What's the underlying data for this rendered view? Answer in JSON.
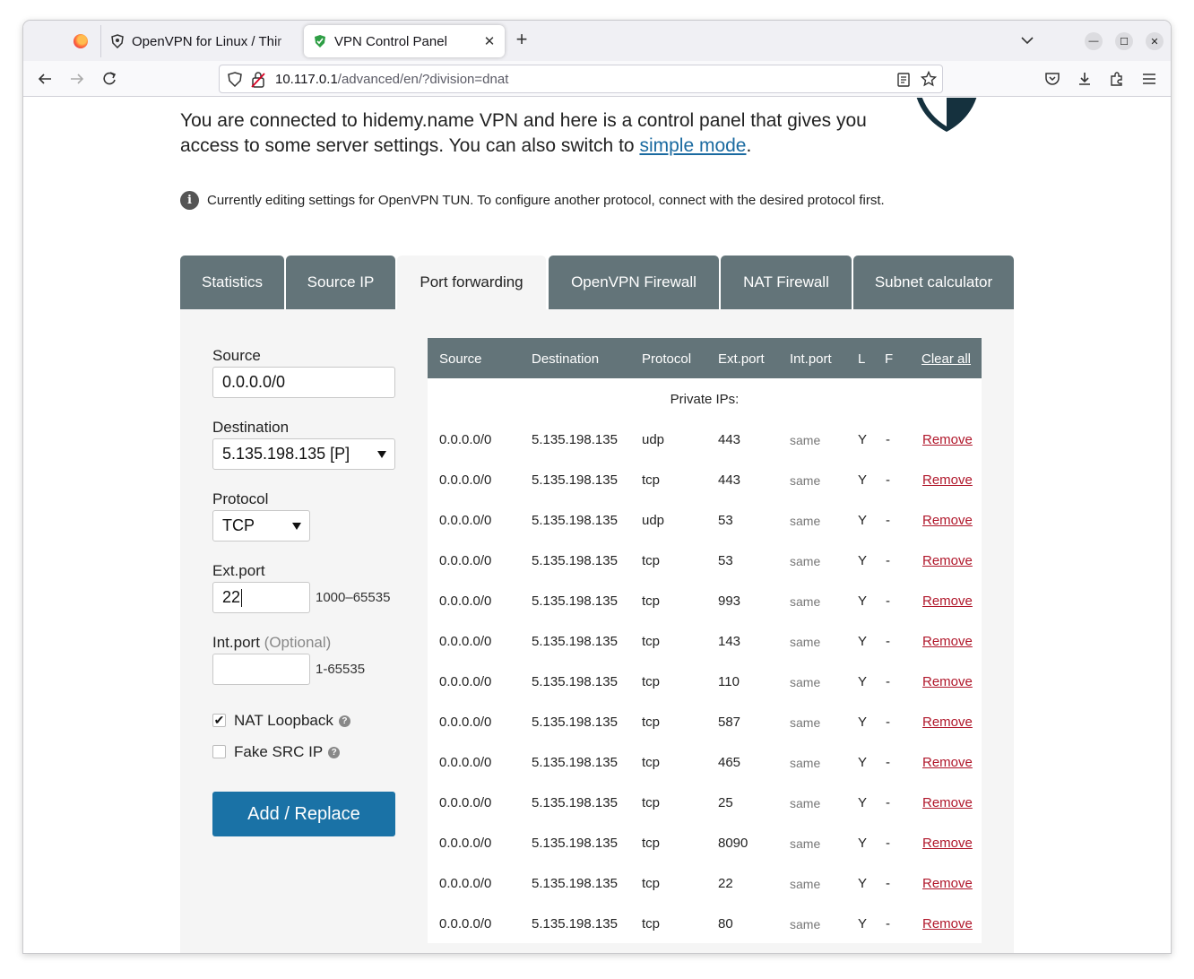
{
  "browser": {
    "tabs": [
      {
        "title": "OpenVPN for Linux / Thir",
        "active": false
      },
      {
        "title": "VPN Control Panel",
        "active": true
      }
    ],
    "url_host": "10.117.0.1",
    "url_path": "/advanced/en/?division=dnat"
  },
  "intro": {
    "text": "You are connected to hidemy.name VPN and here is a control panel that gives you access to some server settings. You can also switch to",
    "link": "simple mode",
    "end": "."
  },
  "info": "Currently editing settings for OpenVPN TUN. To configure another protocol, connect with the desired protocol first.",
  "page_tabs": [
    "Statistics",
    "Source IP",
    "Port forwarding",
    "OpenVPN Firewall",
    "NAT Firewall",
    "Subnet calculator"
  ],
  "form": {
    "source_label": "Source",
    "source_value": "0.0.0.0/0",
    "destination_label": "Destination",
    "destination_value": "5.135.198.135 [P]",
    "protocol_label": "Protocol",
    "protocol_value": "TCP",
    "ext_port_label": "Ext.port",
    "ext_port_value": "22",
    "ext_port_range": "1000–65535",
    "int_port_label": "Int.port",
    "int_port_optional": "(Optional)",
    "int_port_value": "",
    "int_port_range": "1-65535",
    "nat_loopback_label": "NAT Loopback",
    "nat_loopback_checked": true,
    "fake_src_label": "Fake SRC IP",
    "fake_src_checked": false,
    "submit_label": "Add / Replace"
  },
  "table": {
    "headers": [
      "Source",
      "Destination",
      "Protocol",
      "Ext.port",
      "Int.port",
      "L",
      "F"
    ],
    "clear_all": "Clear all",
    "private_ips_label": "Private IPs:",
    "remove_label": "Remove",
    "rows": [
      {
        "source": "0.0.0.0/0",
        "destination": "5.135.198.135",
        "protocol": "udp",
        "ext": "443",
        "int": "same",
        "l": "Y",
        "f": "-"
      },
      {
        "source": "0.0.0.0/0",
        "destination": "5.135.198.135",
        "protocol": "tcp",
        "ext": "443",
        "int": "same",
        "l": "Y",
        "f": "-"
      },
      {
        "source": "0.0.0.0/0",
        "destination": "5.135.198.135",
        "protocol": "udp",
        "ext": "53",
        "int": "same",
        "l": "Y",
        "f": "-"
      },
      {
        "source": "0.0.0.0/0",
        "destination": "5.135.198.135",
        "protocol": "tcp",
        "ext": "53",
        "int": "same",
        "l": "Y",
        "f": "-"
      },
      {
        "source": "0.0.0.0/0",
        "destination": "5.135.198.135",
        "protocol": "tcp",
        "ext": "993",
        "int": "same",
        "l": "Y",
        "f": "-"
      },
      {
        "source": "0.0.0.0/0",
        "destination": "5.135.198.135",
        "protocol": "tcp",
        "ext": "143",
        "int": "same",
        "l": "Y",
        "f": "-"
      },
      {
        "source": "0.0.0.0/0",
        "destination": "5.135.198.135",
        "protocol": "tcp",
        "ext": "110",
        "int": "same",
        "l": "Y",
        "f": "-"
      },
      {
        "source": "0.0.0.0/0",
        "destination": "5.135.198.135",
        "protocol": "tcp",
        "ext": "587",
        "int": "same",
        "l": "Y",
        "f": "-"
      },
      {
        "source": "0.0.0.0/0",
        "destination": "5.135.198.135",
        "protocol": "tcp",
        "ext": "465",
        "int": "same",
        "l": "Y",
        "f": "-"
      },
      {
        "source": "0.0.0.0/0",
        "destination": "5.135.198.135",
        "protocol": "tcp",
        "ext": "25",
        "int": "same",
        "l": "Y",
        "f": "-"
      },
      {
        "source": "0.0.0.0/0",
        "destination": "5.135.198.135",
        "protocol": "tcp",
        "ext": "8090",
        "int": "same",
        "l": "Y",
        "f": "-"
      },
      {
        "source": "0.0.0.0/0",
        "destination": "5.135.198.135",
        "protocol": "tcp",
        "ext": "22",
        "int": "same",
        "l": "Y",
        "f": "-"
      },
      {
        "source": "0.0.0.0/0",
        "destination": "5.135.198.135",
        "protocol": "tcp",
        "ext": "80",
        "int": "same",
        "l": "Y",
        "f": "-"
      }
    ]
  },
  "colors": {
    "tab_bg": "#637479",
    "button": "#1a72a6",
    "remove_link": "#b0162a",
    "link": "#1a6aa0"
  }
}
